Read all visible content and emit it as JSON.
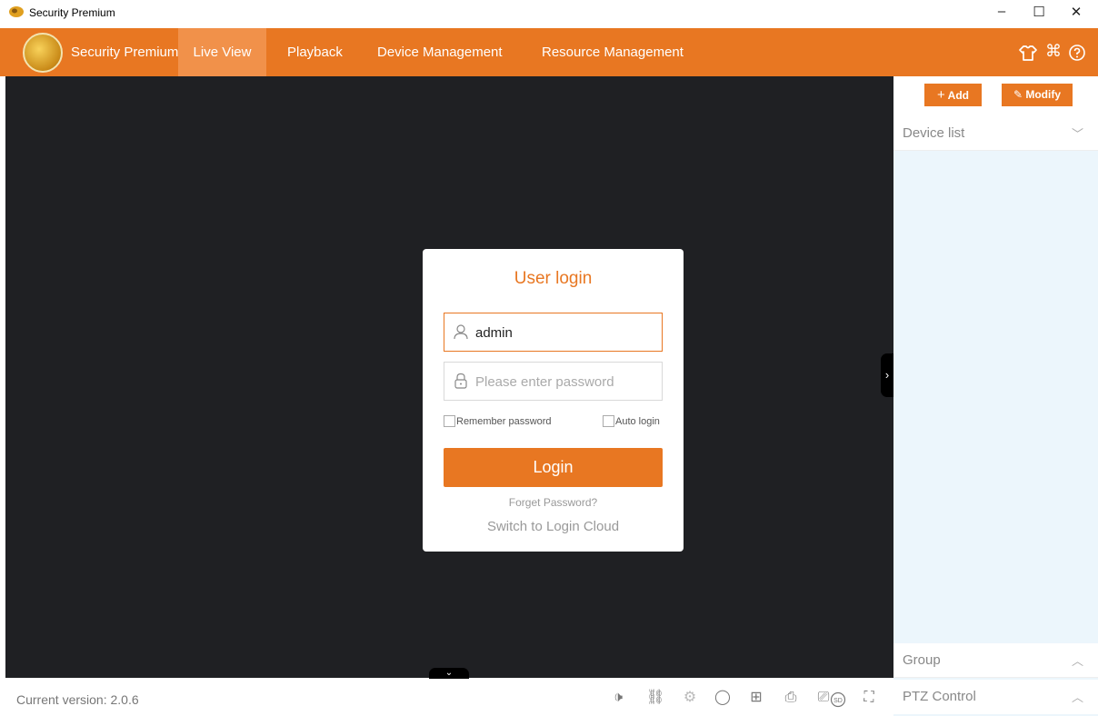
{
  "window": {
    "title": "Security Premium",
    "controls": {
      "minimize": "–",
      "maximize": "☐",
      "close": "✕"
    }
  },
  "nav": {
    "brand": "Security Premium",
    "items": [
      {
        "label": "Live View",
        "active": true
      },
      {
        "label": "Playback",
        "active": false
      },
      {
        "label": "Device Management",
        "active": false
      },
      {
        "label": "Resource Management",
        "active": false
      }
    ],
    "right_icons": [
      "shirt-icon",
      "command-icon",
      "help-icon"
    ]
  },
  "login": {
    "heading": "User login",
    "username_value": "admin",
    "password_placeholder": "Please enter password",
    "remember_label": "Remember password",
    "auto_login_label": "Auto login",
    "login_button": "Login",
    "forget_link": "Forget Password?",
    "switch_link": "Switch to Login Cloud"
  },
  "right_panel": {
    "add_button": "Add",
    "modify_button": "Modify",
    "device_list": "Device list",
    "group": "Group",
    "ptz": "PTZ Control"
  },
  "status": {
    "version": "Current version: 2.0.6",
    "toolbar_icons": [
      "volume-icon",
      "unlink-icon",
      "settings-icon",
      "circle-icon",
      "grid-icon",
      "snapshot-icon",
      "record-icon",
      "sd-icon",
      "fullscreen-icon"
    ]
  },
  "colors": {
    "accent": "#e87722",
    "stage": "#1f2023",
    "panel_bg": "#ecf6fc"
  }
}
